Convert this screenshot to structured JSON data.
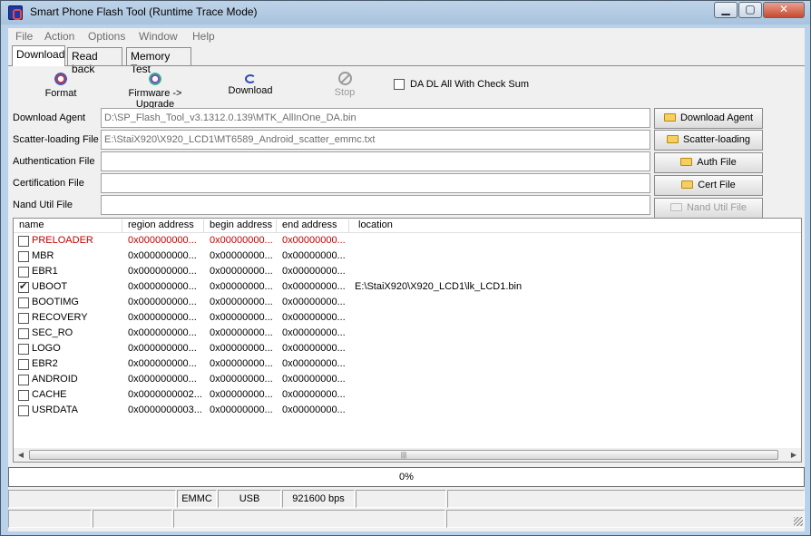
{
  "window": {
    "title": "Smart Phone Flash Tool (Runtime Trace Mode)"
  },
  "menu": {
    "items": [
      "File",
      "Action",
      "Options",
      "Window",
      "Help"
    ]
  },
  "tabs": [
    "Download",
    "Read back",
    "Memory Test"
  ],
  "toolbar": {
    "format": "Format",
    "firmware_upgrade": "Firmware -> Upgrade",
    "download": "Download",
    "stop": "Stop",
    "checksum_label": "DA DL All With Check Sum"
  },
  "files": {
    "download_agent": {
      "label": "Download Agent",
      "value": "D:\\SP_Flash_Tool_v3.1312.0.139\\MTK_AllInOne_DA.bin",
      "button": "Download Agent"
    },
    "scatter": {
      "label": "Scatter-loading File",
      "value": "E:\\StaiX920\\X920_LCD1\\MT6589_Android_scatter_emmc.txt",
      "button": "Scatter-loading"
    },
    "auth": {
      "label": "Authentication File",
      "value": "",
      "button": "Auth File"
    },
    "cert": {
      "label": "Certification File",
      "value": "",
      "button": "Cert File"
    },
    "nand": {
      "label": "Nand Util File",
      "value": "",
      "button": "Nand Util File"
    }
  },
  "table": {
    "columns": [
      "name",
      "region address",
      "begin address",
      "end address",
      "location"
    ],
    "rows": [
      {
        "name": "PRELOADER",
        "region": "0x000000000...",
        "begin": "0x00000000...",
        "end": "0x00000000...",
        "location": "",
        "checked": false,
        "highlight": true
      },
      {
        "name": "MBR",
        "region": "0x000000000...",
        "begin": "0x00000000...",
        "end": "0x00000000...",
        "location": "",
        "checked": false,
        "highlight": false
      },
      {
        "name": "EBR1",
        "region": "0x000000000...",
        "begin": "0x00000000...",
        "end": "0x00000000...",
        "location": "",
        "checked": false,
        "highlight": false
      },
      {
        "name": "UBOOT",
        "region": "0x000000000...",
        "begin": "0x00000000...",
        "end": "0x00000000...",
        "location": "E:\\StaiX920\\X920_LCD1\\lk_LCD1.bin",
        "checked": true,
        "highlight": false
      },
      {
        "name": "BOOTIMG",
        "region": "0x000000000...",
        "begin": "0x00000000...",
        "end": "0x00000000...",
        "location": "",
        "checked": false,
        "highlight": false
      },
      {
        "name": "RECOVERY",
        "region": "0x000000000...",
        "begin": "0x00000000...",
        "end": "0x00000000...",
        "location": "",
        "checked": false,
        "highlight": false
      },
      {
        "name": "SEC_RO",
        "region": "0x000000000...",
        "begin": "0x00000000...",
        "end": "0x00000000...",
        "location": "",
        "checked": false,
        "highlight": false
      },
      {
        "name": "LOGO",
        "region": "0x000000000...",
        "begin": "0x00000000...",
        "end": "0x00000000...",
        "location": "",
        "checked": false,
        "highlight": false
      },
      {
        "name": "EBR2",
        "region": "0x000000000...",
        "begin": "0x00000000...",
        "end": "0x00000000...",
        "location": "",
        "checked": false,
        "highlight": false
      },
      {
        "name": "ANDROID",
        "region": "0x000000000...",
        "begin": "0x00000000...",
        "end": "0x00000000...",
        "location": "",
        "checked": false,
        "highlight": false
      },
      {
        "name": "CACHE",
        "region": "0x0000000002...",
        "begin": "0x00000000...",
        "end": "0x00000000...",
        "location": "",
        "checked": false,
        "highlight": false
      },
      {
        "name": "USRDATA",
        "region": "0x0000000003...",
        "begin": "0x00000000...",
        "end": "0x00000000...",
        "location": "",
        "checked": false,
        "highlight": false
      }
    ]
  },
  "progress": {
    "text": "0%",
    "value": 0
  },
  "status": {
    "storage": "EMMC",
    "port": "USB",
    "baud": "921600 bps"
  },
  "icons": [
    "app-icon",
    "format-icon",
    "firmware-upgrade-icon",
    "download-icon",
    "stop-icon",
    "folder-icon"
  ],
  "colors": {
    "highlight_row": "#c00000",
    "title_bar": "#b9d1ea"
  }
}
